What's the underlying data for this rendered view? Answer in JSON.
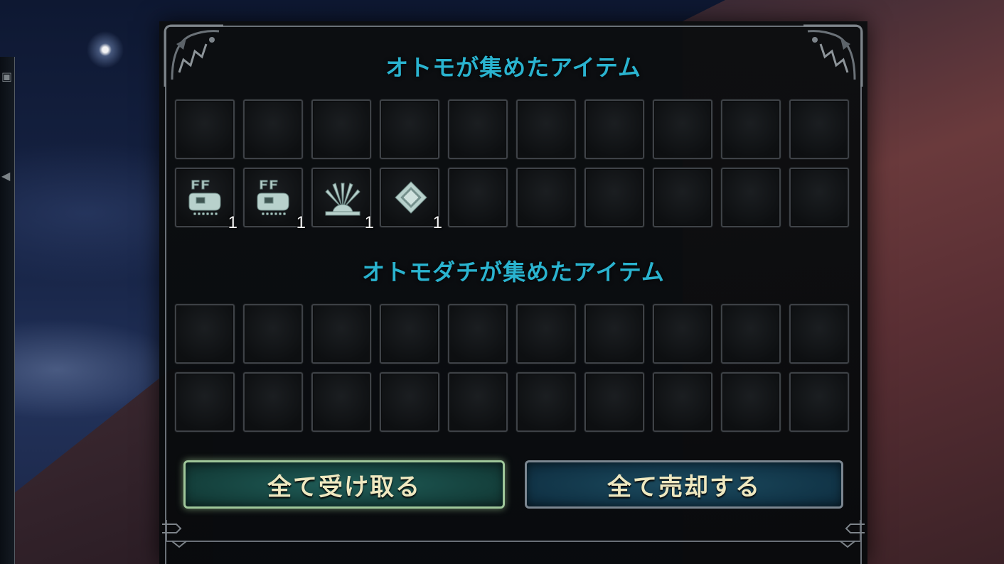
{
  "otomo_section": {
    "title": "オトモが集めたアイテム",
    "slots": [
      {
        "icon": "",
        "qty": ""
      },
      {
        "icon": "",
        "qty": ""
      },
      {
        "icon": "",
        "qty": ""
      },
      {
        "icon": "",
        "qty": ""
      },
      {
        "icon": "",
        "qty": ""
      },
      {
        "icon": "",
        "qty": ""
      },
      {
        "icon": "",
        "qty": ""
      },
      {
        "icon": "",
        "qty": ""
      },
      {
        "icon": "",
        "qty": ""
      },
      {
        "icon": "",
        "qty": ""
      },
      {
        "icon": "item-pouch-icon",
        "qty": "1"
      },
      {
        "icon": "item-pouch-icon",
        "qty": "1"
      },
      {
        "icon": "sunburst-item-icon",
        "qty": "1"
      },
      {
        "icon": "ore-item-icon",
        "qty": "1"
      },
      {
        "icon": "",
        "qty": ""
      },
      {
        "icon": "",
        "qty": ""
      },
      {
        "icon": "",
        "qty": ""
      },
      {
        "icon": "",
        "qty": ""
      },
      {
        "icon": "",
        "qty": ""
      },
      {
        "icon": "",
        "qty": ""
      }
    ]
  },
  "tailraider_section": {
    "title": "オトモダチが集めたアイテム",
    "slots": [
      {
        "icon": "",
        "qty": ""
      },
      {
        "icon": "",
        "qty": ""
      },
      {
        "icon": "",
        "qty": ""
      },
      {
        "icon": "",
        "qty": ""
      },
      {
        "icon": "",
        "qty": ""
      },
      {
        "icon": "",
        "qty": ""
      },
      {
        "icon": "",
        "qty": ""
      },
      {
        "icon": "",
        "qty": ""
      },
      {
        "icon": "",
        "qty": ""
      },
      {
        "icon": "",
        "qty": ""
      },
      {
        "icon": "",
        "qty": ""
      },
      {
        "icon": "",
        "qty": ""
      },
      {
        "icon": "",
        "qty": ""
      },
      {
        "icon": "",
        "qty": ""
      },
      {
        "icon": "",
        "qty": ""
      },
      {
        "icon": "",
        "qty": ""
      },
      {
        "icon": "",
        "qty": ""
      },
      {
        "icon": "",
        "qty": ""
      },
      {
        "icon": "",
        "qty": ""
      },
      {
        "icon": "",
        "qty": ""
      }
    ]
  },
  "buttons": {
    "take_all": "全て受け取る",
    "sell_all": "全て売却する"
  },
  "colors": {
    "title": "#2ab3cf",
    "button_text": "#eee8c0",
    "selected_button_border": "#9fc79a"
  }
}
